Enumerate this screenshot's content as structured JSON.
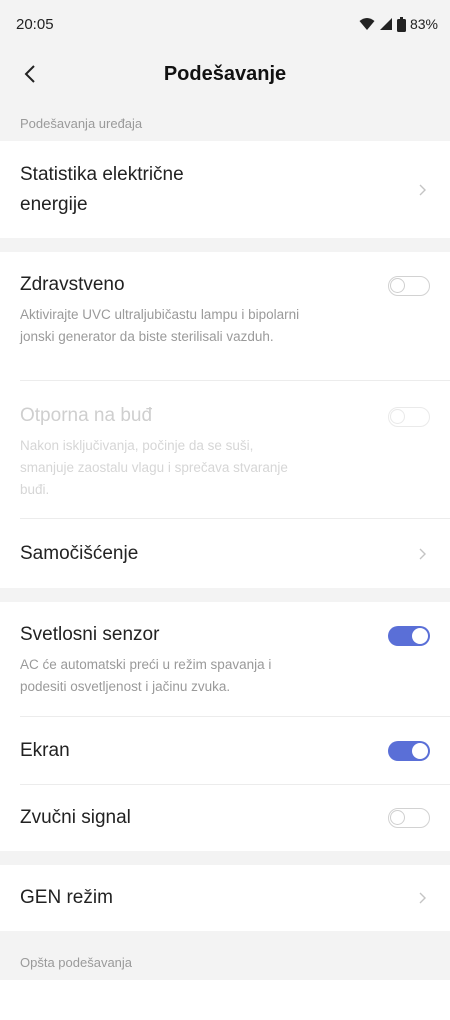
{
  "status": {
    "time": "20:05",
    "battery": "83%"
  },
  "header": {
    "title": "Podešavanje"
  },
  "sections": {
    "device_label": "Podešavanja uređaja",
    "general_label": "Opšta podešavanja"
  },
  "items": {
    "statistics": {
      "title_line1": "Statistika električne",
      "title_line2": "energije"
    },
    "healthy": {
      "title": "Zdravstveno",
      "desc_line1": "Aktivirajte UVC ultraljubičastu lampu i bipolarni",
      "desc_line2": "jonski generator da biste sterilisali vazduh.",
      "enabled": false
    },
    "anti_mold": {
      "title": "Otporna na buđ",
      "desc_line1": "Nakon isključivanja, počinje da se suši,",
      "desc_line2": "smanjuje zaostalu vlagu i sprečava stvaranje",
      "desc_line3": "buđi.",
      "enabled": false,
      "disabled": true
    },
    "self_clean": {
      "title": "Samočišćenje"
    },
    "light_sensor": {
      "title": "Svetlosni senzor",
      "desc_line1": "AC će automatski preći u režim spavanja i",
      "desc_line2": "podesiti osvetljenost i jačinu zvuka.",
      "enabled": true
    },
    "screen": {
      "title": "Ekran",
      "enabled": true
    },
    "beep": {
      "title": "Zvučni signal",
      "enabled": false
    },
    "gen_mode": {
      "title": "GEN režim"
    }
  },
  "colors": {
    "accent": "#5a6fd7",
    "background": "#f3f3f3",
    "muted_text": "#9a9a9a"
  }
}
